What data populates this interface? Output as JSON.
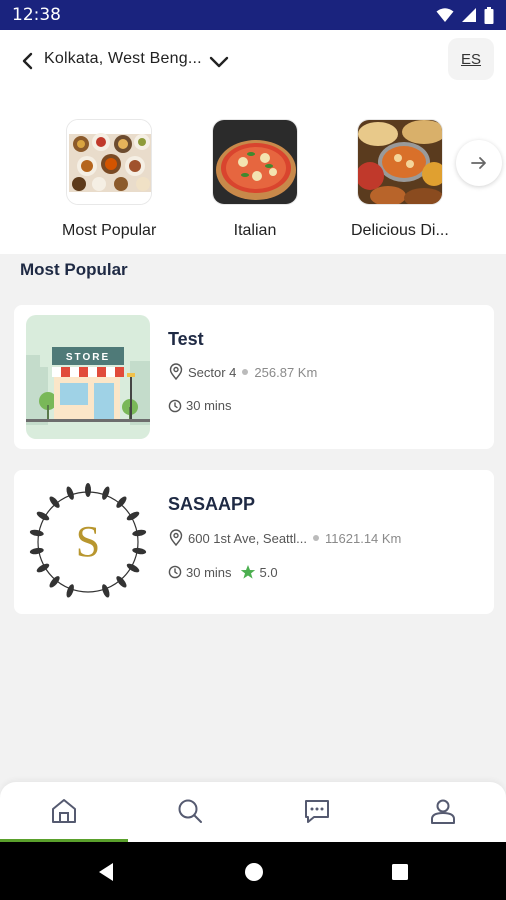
{
  "status_bar": {
    "time": "12:38"
  },
  "header": {
    "location": "Kolkata, West Beng...",
    "language": "ES"
  },
  "categories": [
    {
      "label": "Most Popular"
    },
    {
      "label": "Italian"
    },
    {
      "label": "Delicious Di..."
    }
  ],
  "section_title": "Most Popular",
  "restaurants": [
    {
      "name": "Test",
      "address": "Sector 4",
      "distance": "256.87 Km",
      "time": "30 mins",
      "logo_text": "STORE"
    },
    {
      "name": "SASAAPP",
      "address": "600 1st Ave, Seattl...",
      "distance": "11621.14 Km",
      "time": "30 mins",
      "rating": "5.0",
      "logo_letter": "S"
    }
  ],
  "bottom_nav": [
    "home-icon",
    "search-icon",
    "chat-icon",
    "profile-icon"
  ],
  "colors": {
    "status_bar": "#1a237e",
    "title": "#1f2a44",
    "accent": "#5aa02c",
    "star": "#4caf50",
    "logo_gold": "#b8962e"
  }
}
